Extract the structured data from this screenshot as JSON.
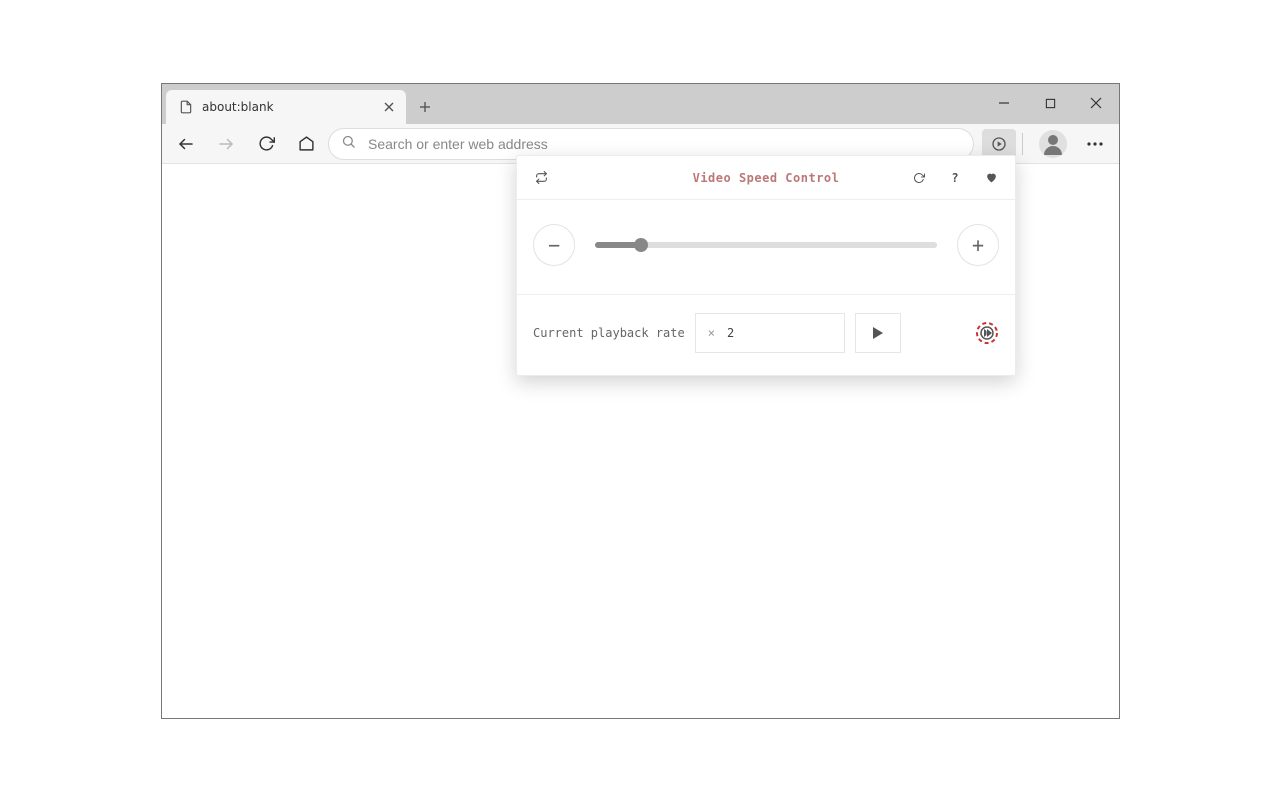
{
  "tab": {
    "title": "about:blank"
  },
  "address_bar": {
    "value": "",
    "placeholder": "Search or enter web address"
  },
  "extension_popup": {
    "title": "Video Speed Control",
    "decrease_label": "−",
    "increase_label": "+",
    "slider": {
      "min": 0.1,
      "max": 16,
      "step": 0.1,
      "value": 2
    },
    "rate_label": "Current playback rate",
    "rate_prefix": "×",
    "rate_value": "2",
    "header_icons": {
      "left1_name": "loop-icon",
      "right1_name": "reload-icon",
      "right2_name": "help-icon",
      "right3_name": "favorite-icon",
      "right2_glyph": "?"
    }
  }
}
